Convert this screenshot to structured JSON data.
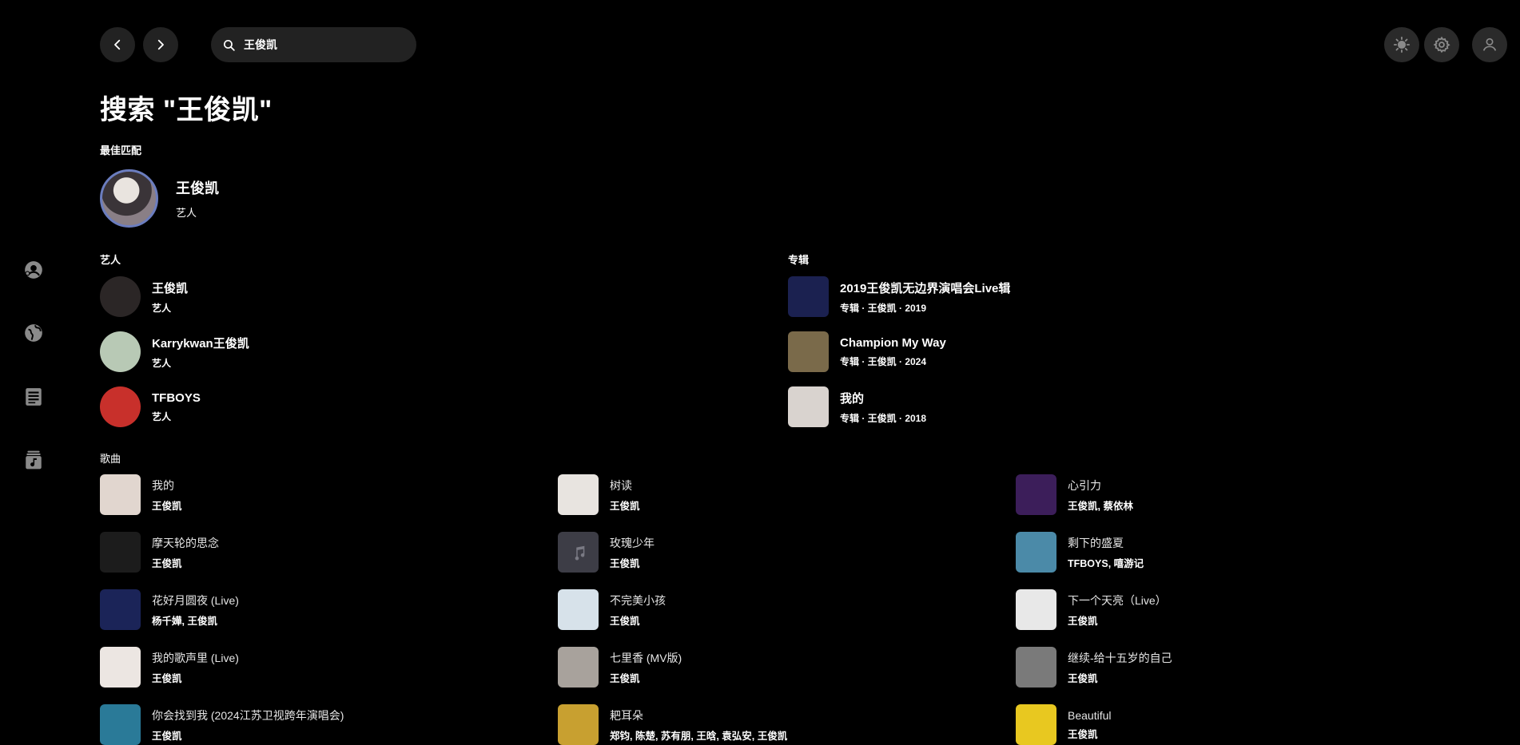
{
  "search": {
    "query": "王俊凯"
  },
  "page_title": "搜索 \"王俊凯\"",
  "sections": {
    "best_match": "最佳匹配",
    "artists": "艺人",
    "albums": "专辑",
    "songs": "歌曲"
  },
  "best_match": {
    "name": "王俊凯",
    "type": "艺人"
  },
  "artists": [
    {
      "name": "王俊凯",
      "type": "艺人",
      "color": "#2b2626"
    },
    {
      "name": "Karrykwan王俊凯",
      "type": "艺人",
      "color": "#b8c9b5"
    },
    {
      "name": "TFBOYS",
      "type": "艺人",
      "color": "#c8302b"
    }
  ],
  "albums": [
    {
      "name": "2019王俊凯无边界演唱会Live辑",
      "meta": "专辑 · 王俊凯 · 2019",
      "color": "#1b2150"
    },
    {
      "name": "Champion My Way",
      "meta": "专辑 · 王俊凯 · 2024",
      "color": "#7a6a4a"
    },
    {
      "name": "我的",
      "meta": "专辑 · 王俊凯 · 2018",
      "color": "#d9d3cf"
    }
  ],
  "songs": [
    {
      "title": "我的",
      "artist": "王俊凯",
      "color": "#e1d6cf"
    },
    {
      "title": "树读",
      "artist": "王俊凯",
      "color": "#e8e4e0"
    },
    {
      "title": "心引力",
      "artist": "王俊凯, 蔡依林",
      "color": "#3c1e5a"
    },
    {
      "title": "摩天轮的思念",
      "artist": "王俊凯",
      "color": "#1c1c1c"
    },
    {
      "title": "玫瑰少年",
      "artist": "王俊凯",
      "color": "#3d3d46"
    },
    {
      "title": "剩下的盛夏",
      "artist": "TFBOYS, 嘻游记",
      "color": "#4b8aa8"
    },
    {
      "title": "花好月圆夜 (Live)",
      "artist": "杨千嬅, 王俊凯",
      "color": "#1b2458"
    },
    {
      "title": "不完美小孩",
      "artist": "王俊凯",
      "color": "#d7e2ea"
    },
    {
      "title": "下一个天亮（Live）",
      "artist": "王俊凯",
      "color": "#e8e8e8"
    },
    {
      "title": "我的歌声里 (Live)",
      "artist": "王俊凯",
      "color": "#ece6e2"
    },
    {
      "title": "七里香 (MV版)",
      "artist": "王俊凯",
      "color": "#a8a29c"
    },
    {
      "title": "继续-给十五岁的自己",
      "artist": "王俊凯",
      "color": "#7a7a7a"
    },
    {
      "title": "你会找到我 (2024江苏卫视跨年演唱会)",
      "artist": "王俊凯",
      "color": "#2a7a98"
    },
    {
      "title": "耙耳朵",
      "artist": "郑钧, 陈楚, 苏有朋, 王晗, 袁弘安, 王俊凯",
      "color": "#c8a030"
    },
    {
      "title": "Beautiful",
      "artist": "王俊凯",
      "color": "#e8c820"
    }
  ]
}
